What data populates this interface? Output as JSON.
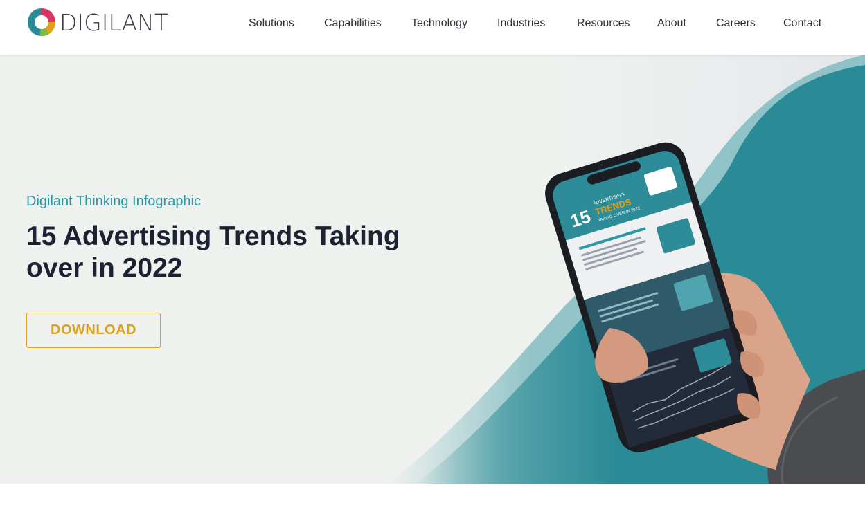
{
  "brand": {
    "name": "DIGILANT"
  },
  "nav": {
    "items": [
      {
        "label": "Solutions"
      },
      {
        "label": "Capabilities"
      },
      {
        "label": "Technology"
      },
      {
        "label": "Industries"
      },
      {
        "label": "Resources"
      },
      {
        "label": "About"
      },
      {
        "label": "Careers"
      },
      {
        "label": "Contact"
      }
    ]
  },
  "hero": {
    "eyebrow": "Digilant Thinking Infographic",
    "title": "15 Advertising Trends Taking over in 2022",
    "download_label": "DOWNLOAD",
    "phone_screen": {
      "number": "15",
      "kicker": "ADVERTISING",
      "headline": "TRENDS",
      "subhead": "TAKING OVER IN 2022"
    }
  },
  "colors": {
    "accent_teal": "#2b98a3",
    "cta_gold": "#e0a31c",
    "title_navy": "#1d2233",
    "hero_bg": "#eff1ef",
    "wave_teal": "#2a8a95"
  }
}
